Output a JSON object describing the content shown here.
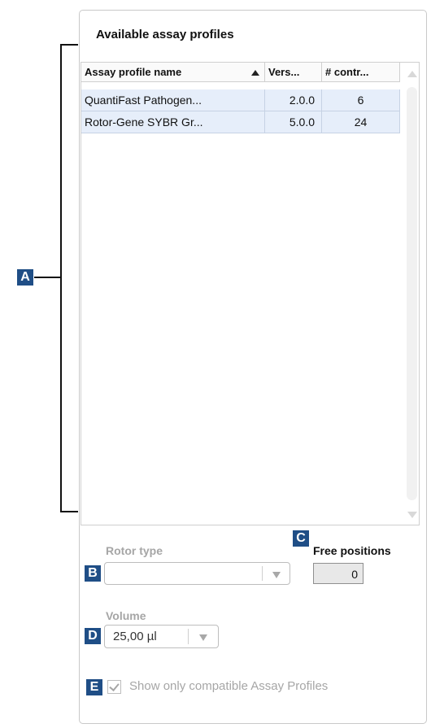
{
  "panel": {
    "title": "Available assay profiles"
  },
  "table": {
    "columns": [
      {
        "label": "Assay profile name",
        "sort": "ascending"
      },
      {
        "label": "Vers..."
      },
      {
        "label": "# contr..."
      }
    ],
    "rows": [
      {
        "name": "QuantiFast Pathogen...",
        "version": "2.0.0",
        "controls": "6"
      },
      {
        "name": "Rotor-Gene SYBR Gr...",
        "version": "5.0.0",
        "controls": "24"
      }
    ],
    "row_color": "#e6eefa"
  },
  "rotor_type": {
    "label": "Rotor type",
    "value": ""
  },
  "free_positions": {
    "label": "Free positions",
    "value": "0"
  },
  "volume": {
    "label": "Volume",
    "value": "25,00 µl"
  },
  "compatible_only": {
    "label": "Show only compatible Assay Profiles",
    "checked": true
  },
  "callouts": {
    "a": "A",
    "b": "B",
    "c": "C",
    "d": "D",
    "e": "E",
    "color": "#1f4e86"
  }
}
